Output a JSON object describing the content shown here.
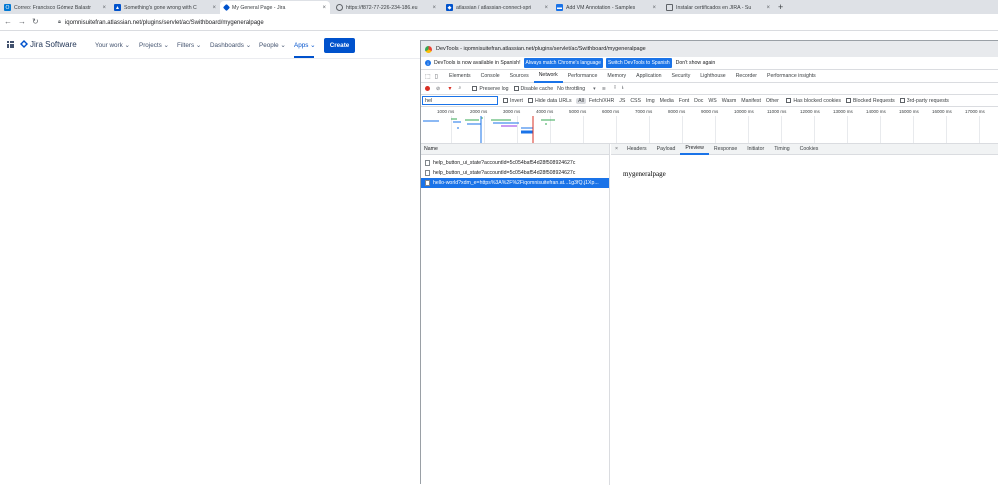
{
  "browser": {
    "tabs": [
      {
        "title": "Correo: Francisco Gómez Balastr",
        "icon": "outlook-icon",
        "color": "#0078d4"
      },
      {
        "title": "Something's gone wrong with C",
        "icon": "atlassian-icon",
        "color": "#0052cc"
      },
      {
        "title": "My General Page - Jira",
        "icon": "jira-icon",
        "color": "#0052cc",
        "active": true
      },
      {
        "title": "https://f872-77-226-234-186.eu",
        "icon": "globe-icon",
        "color": "#5f6368"
      },
      {
        "title": "atlassian / atlassian-connect-spri",
        "icon": "bitbucket-icon",
        "color": "#0052cc"
      },
      {
        "title": "Add VM Annotation - Samples",
        "icon": "docs-icon",
        "color": "#1a73e8"
      },
      {
        "title": "Instalar certificados en JIRA - Su",
        "icon": "page-icon",
        "color": "#5f6368"
      }
    ],
    "new_tab": "+",
    "url": "iqomnisuitefran.atlassian.net/plugins/servlet/ac/Swithboard/mygeneralpage"
  },
  "jira": {
    "logo": "Jira Software",
    "nav": [
      "Your work",
      "Projects",
      "Filters",
      "Dashboards",
      "People",
      "Apps"
    ],
    "create": "Create"
  },
  "devtools": {
    "title": "DevTools - iqomnisuitefran.atlassian.net/plugins/servlet/ac/Swithboard/mygeneralpage",
    "banner": {
      "text": "DevTools is now available in Spanish!",
      "btn1": "Always match Chrome's language",
      "btn2": "Switch DevTools to Spanish",
      "dismiss": "Don't show again"
    },
    "tabs": [
      "Elements",
      "Console",
      "Sources",
      "Network",
      "Performance",
      "Memory",
      "Application",
      "Security",
      "Lighthouse",
      "Recorder",
      "Performance insights"
    ],
    "active_tab": "Network",
    "net_toolbar": {
      "preserve": "Preserve log",
      "disable_cache": "Disable cache",
      "throttle": "No throttling"
    },
    "filter": {
      "value": "hel",
      "invert": "Invert",
      "hide_data": "Hide data URLs",
      "types": [
        "All",
        "Fetch/XHR",
        "JS",
        "CSS",
        "Img",
        "Media",
        "Font",
        "Doc",
        "WS",
        "Wasm",
        "Manifest",
        "Other"
      ],
      "blocked_cookies": "Has blocked cookies",
      "blocked_requests": "Blocked Requests",
      "third_party": "3rd-party requests"
    },
    "timeline_ticks": [
      "1000 ms",
      "2000 ms",
      "3000 ms",
      "4000 ms",
      "5000 ms",
      "6000 ms",
      "7000 ms",
      "8000 ms",
      "9000 ms",
      "10000 ms",
      "11000 ms",
      "12000 ms",
      "13000 ms",
      "14000 ms",
      "15000 ms",
      "16000 ms",
      "17000 ms"
    ],
    "name_header": "Name",
    "requests": [
      "help_button_ui_state?accountId=5c054baf54d28f508924627c",
      "help_button_ui_state?accountId=5c054baf54d28f508924627c",
      "hello-world?xdm_e=https%3A%2F%2Fiqomnisuitefran.at...1g3fQ.j1Xp..."
    ],
    "detail_tabs": [
      "Headers",
      "Payload",
      "Preview",
      "Response",
      "Initiator",
      "Timing",
      "Cookies"
    ],
    "active_detail_tab": "Preview",
    "preview_text": "mygeneralpage"
  }
}
